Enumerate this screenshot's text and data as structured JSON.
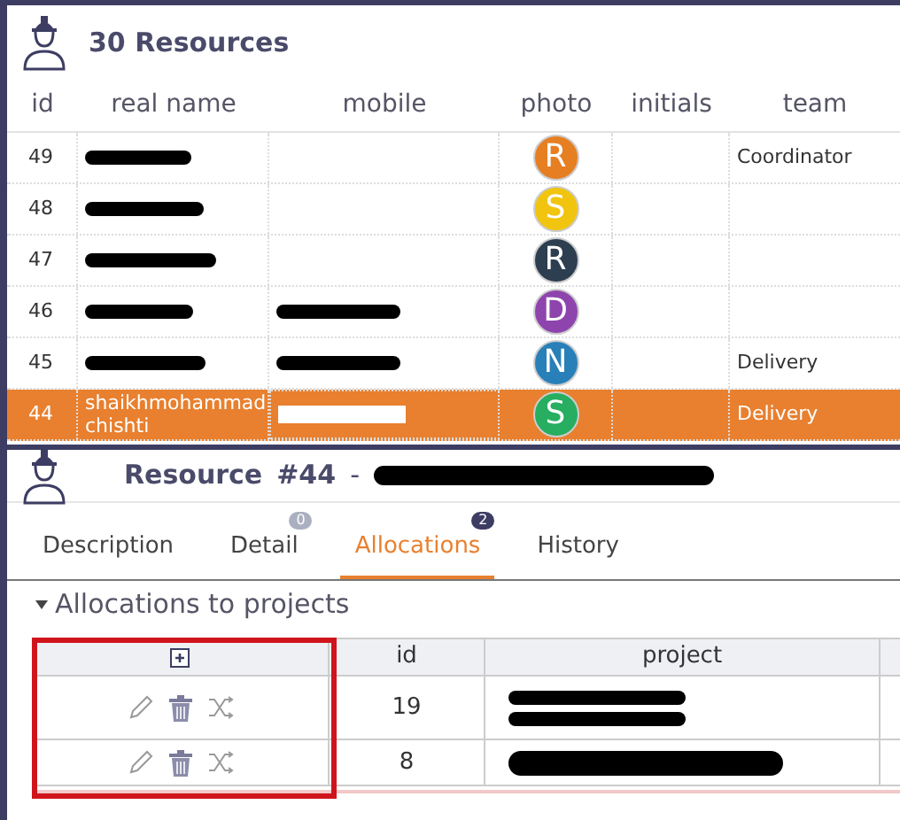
{
  "list_header": {
    "title": "30 Resources"
  },
  "columns": [
    "id",
    "real name",
    "mobile",
    "photo",
    "initials",
    "team"
  ],
  "rows": [
    {
      "id": "49",
      "name_redacted": true,
      "mobile_redacted": false,
      "avatar": "R",
      "color": "#e67e22",
      "team": "Coordinator",
      "selected": false
    },
    {
      "id": "48",
      "name_redacted": true,
      "mobile_redacted": false,
      "avatar": "S",
      "color": "#f1c40f",
      "selected": false
    },
    {
      "id": "47",
      "name_redacted": true,
      "mobile_redacted": false,
      "avatar": "R",
      "color": "#2c3e50",
      "selected": false
    },
    {
      "id": "46",
      "name_redacted": true,
      "mobile_redacted": true,
      "avatar": "D",
      "color": "#8e44ad",
      "selected": false
    },
    {
      "id": "45",
      "name_redacted": true,
      "mobile_redacted": true,
      "avatar": "N",
      "color": "#2980b9",
      "team": "Delivery",
      "selected": false
    },
    {
      "id": "44",
      "name": "shaikhmohammad chishti",
      "mobile_redacted": true,
      "avatar": "S",
      "color": "#27ae60",
      "team": "Delivery",
      "selected": true
    }
  ],
  "detail": {
    "label": "Resource",
    "number": "#44",
    "separator": "-",
    "name_redacted": true
  },
  "tabs": [
    {
      "label": "Description",
      "selected": false
    },
    {
      "label": "Detail",
      "badge": "0",
      "selected": false
    },
    {
      "label": "Allocations",
      "badge": "2",
      "selected": true
    },
    {
      "label": "History",
      "selected": false
    }
  ],
  "section": {
    "title": "Allocations to projects",
    "expanded": true
  },
  "allocations": {
    "columns": [
      "id",
      "project"
    ],
    "highlight_actions": true,
    "rows": [
      {
        "id": "19",
        "project_redacted": true,
        "kind": "two_line"
      },
      {
        "id": "8",
        "project_redacted": true,
        "kind": "one_line"
      }
    ]
  }
}
